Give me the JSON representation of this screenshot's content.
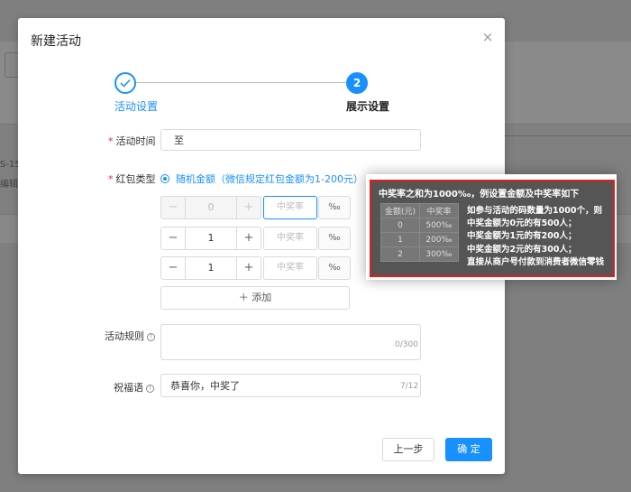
{
  "background": {
    "text1": "S-15",
    "text2": "编辑"
  },
  "modal": {
    "title": "新建活动",
    "close": "×",
    "steps": [
      {
        "label": "活动设置",
        "icon": "check-icon"
      },
      {
        "label": "展示设置",
        "number": "2"
      }
    ],
    "activity_time": {
      "label": "活动时间",
      "value": "至"
    },
    "redpacket": {
      "label": "红包类型",
      "option": "随机金额（微信规定红包金额为1-200元）",
      "rows": [
        {
          "amount": "0",
          "rate_placeholder": "中奖率",
          "unit": "‰",
          "disabled": true
        },
        {
          "amount": "1",
          "rate_placeholder": "中奖率",
          "unit": "‰",
          "disabled": false
        },
        {
          "amount": "1",
          "rate_placeholder": "中奖率",
          "unit": "‰",
          "disabled": false
        }
      ],
      "add_label": "＋ 添加"
    },
    "rules": {
      "label": "活动规则",
      "counter": "0/300"
    },
    "blessing": {
      "label": "祝福语",
      "value": "恭喜你，中奖了",
      "counter": "7/12"
    },
    "buttons": {
      "prev": "上一步",
      "ok": "确 定"
    }
  },
  "tooltip": {
    "title": "中奖率之和为1000‰，例设置金额及中奖率如下",
    "headers": [
      "金额(元)",
      "中奖率"
    ],
    "rows": [
      [
        "0",
        "500‰"
      ],
      [
        "1",
        "200‰"
      ],
      [
        "2",
        "300‰"
      ]
    ],
    "lines": [
      "如参与活动的码数量为1000个，则",
      "中奖金额为0元的有500人；",
      "中奖金额为1元的有200人；",
      "中奖金额为2元的有300人；",
      "直接从商户号付款到消费者微信零钱"
    ],
    "border_color": "#e31b1b"
  },
  "colors": {
    "primary": "#1890ff",
    "required": "#f5222d"
  }
}
